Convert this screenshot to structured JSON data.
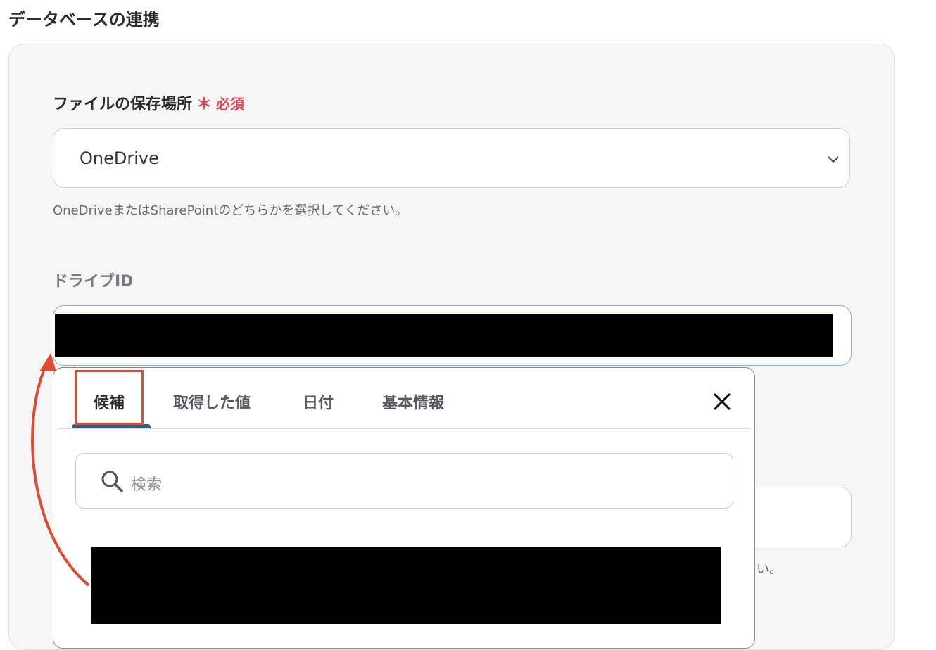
{
  "section": {
    "title": "データベースの連携"
  },
  "storage": {
    "label": "ファイルの保存場所",
    "required_mark": "＊",
    "required_text": "必須",
    "value": "OneDrive",
    "help": "OneDriveまたはSharePointのどちらかを選択してください。"
  },
  "drive": {
    "label": "ドライブID"
  },
  "popup": {
    "tabs": [
      {
        "label": "候補"
      },
      {
        "label": "取得した値"
      },
      {
        "label": "日付"
      },
      {
        "label": "基本情報"
      }
    ],
    "search_placeholder": "検索"
  },
  "background": {
    "snippet": "い。"
  },
  "colors": {
    "required": "#e4475a",
    "annotation": "#e04a33",
    "tab_active": "#35607f"
  },
  "icons": {
    "select_chevron": "chevron-down-icon",
    "close": "close-icon",
    "search": "search-icon"
  }
}
